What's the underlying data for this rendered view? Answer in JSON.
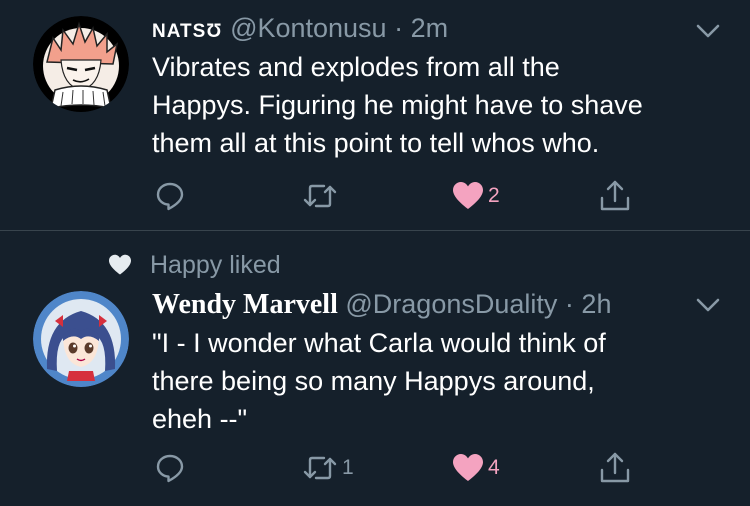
{
  "tweets": [
    {
      "name": "natsʊ",
      "handle": "@Kontonusu",
      "separator": "·",
      "time": "2m",
      "text": "Vibrates and explodes from all the\nHappys. Figuring he might have to shave\nthem all at this point to tell whos who.",
      "actions": {
        "reply_count": "",
        "retweet_count": "",
        "like_count": "2"
      },
      "avatar_icon": "natsu-avatar",
      "liked": true
    },
    {
      "social_context": "Happy liked",
      "name": "Wendy Marvell",
      "handle": "@DragonsDuality",
      "separator": "·",
      "time": "2h",
      "text": "\"I - I wonder what Carla would think of\nthere being so many Happys around,\neheh --\"",
      "actions": {
        "reply_count": "",
        "retweet_count": "1",
        "like_count": "4"
      },
      "avatar_icon": "wendy-avatar",
      "liked": true
    }
  ],
  "colors": {
    "background": "#15202b",
    "divider": "#38444d",
    "secondary_text": "#8899a6",
    "like_heart": "#f4a3c0"
  }
}
